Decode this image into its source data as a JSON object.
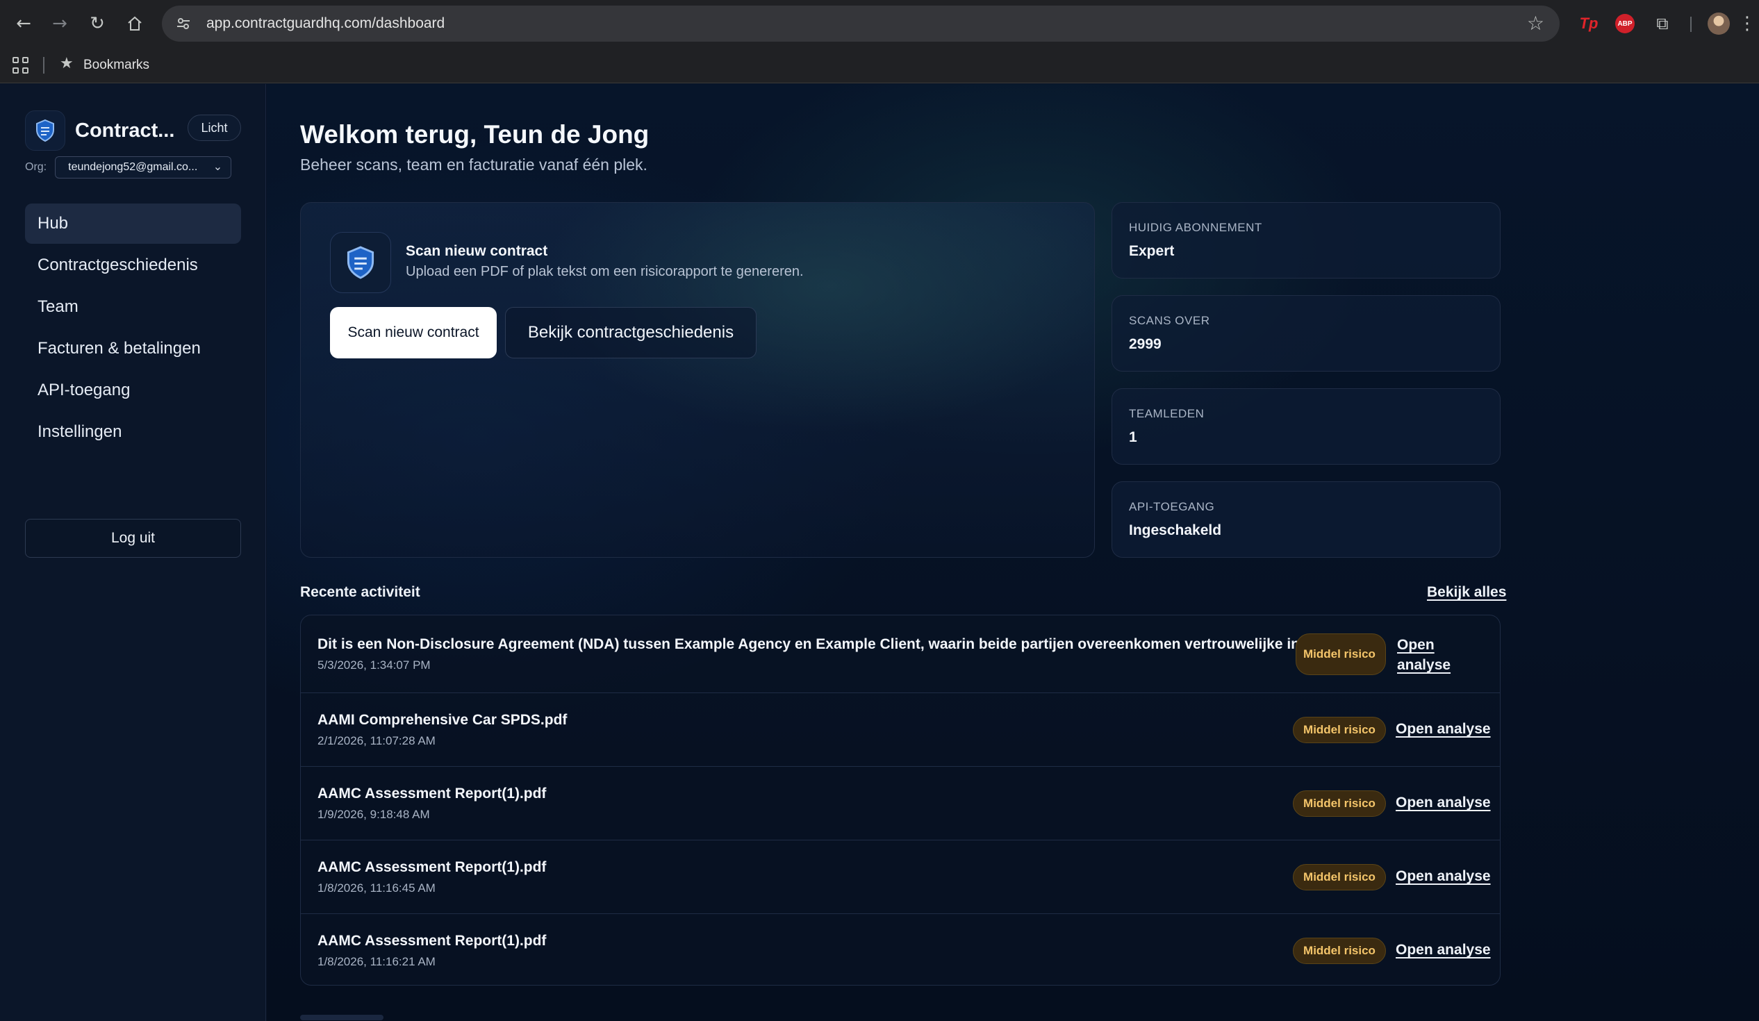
{
  "browser": {
    "url": "app.contractguardhq.com/dashboard",
    "bookmarks_label": "Bookmarks",
    "ext_tp": "Tp",
    "ext_abp": "ABP"
  },
  "sidebar": {
    "brand_name": "Contract...",
    "theme_toggle": "Licht",
    "org_label": "Org:",
    "org_value": "teundejong52@gmail.co...",
    "nav": [
      {
        "label": "Hub",
        "active": true
      },
      {
        "label": "Contractgeschiedenis"
      },
      {
        "label": "Team"
      },
      {
        "label": "Facturen & betalingen"
      },
      {
        "label": "API-toegang"
      },
      {
        "label": "Instellingen"
      }
    ],
    "logout": "Log uit"
  },
  "header": {
    "title": "Welkom terug, Teun de Jong",
    "subtitle": "Beheer scans, team en facturatie vanaf één plek."
  },
  "scan_card": {
    "title": "Scan nieuw contract",
    "description": "Upload een PDF of plak tekst om een risicorapport te genereren.",
    "primary_button": "Scan nieuw contract",
    "secondary_button": "Bekijk contractgeschiedenis"
  },
  "stats": [
    {
      "label": "HUIDIG ABONNEMENT",
      "value": "Expert"
    },
    {
      "label": "SCANS OVER",
      "value": "2999"
    },
    {
      "label": "TEAMLEDEN",
      "value": "1"
    },
    {
      "label": "API-TOEGANG",
      "value": "Ingeschakeld"
    }
  ],
  "recent": {
    "title": "Recente activiteit",
    "view_all": "Bekijk alles",
    "items": [
      {
        "name": "Dit is een Non-Disclosure Agreement (NDA) tussen Example Agency en Example Client, waarin beide partijen overeenkomen vertrouwelijke info...",
        "date": "5/3/2026, 1:34:07 PM",
        "badge": "Middel risico",
        "link": "Open analyse"
      },
      {
        "name": "AAMI Comprehensive Car SPDS.pdf",
        "date": "2/1/2026, 11:07:28 AM",
        "badge": "Middel risico",
        "link": "Open analyse"
      },
      {
        "name": "AAMC Assessment Report(1).pdf",
        "date": "1/9/2026, 9:18:48 AM",
        "badge": "Middel risico",
        "link": "Open analyse"
      },
      {
        "name": "AAMC Assessment Report(1).pdf",
        "date": "1/8/2026, 11:16:45 AM",
        "badge": "Middel risico",
        "link": "Open analyse"
      },
      {
        "name": "AAMC Assessment Report(1).pdf",
        "date": "1/8/2026, 11:16:21 AM",
        "badge": "Middel risico",
        "link": "Open analyse"
      }
    ]
  },
  "colors": {
    "accent": "#3b82f6",
    "badge_text": "#f4c56a",
    "background": "#081224"
  }
}
